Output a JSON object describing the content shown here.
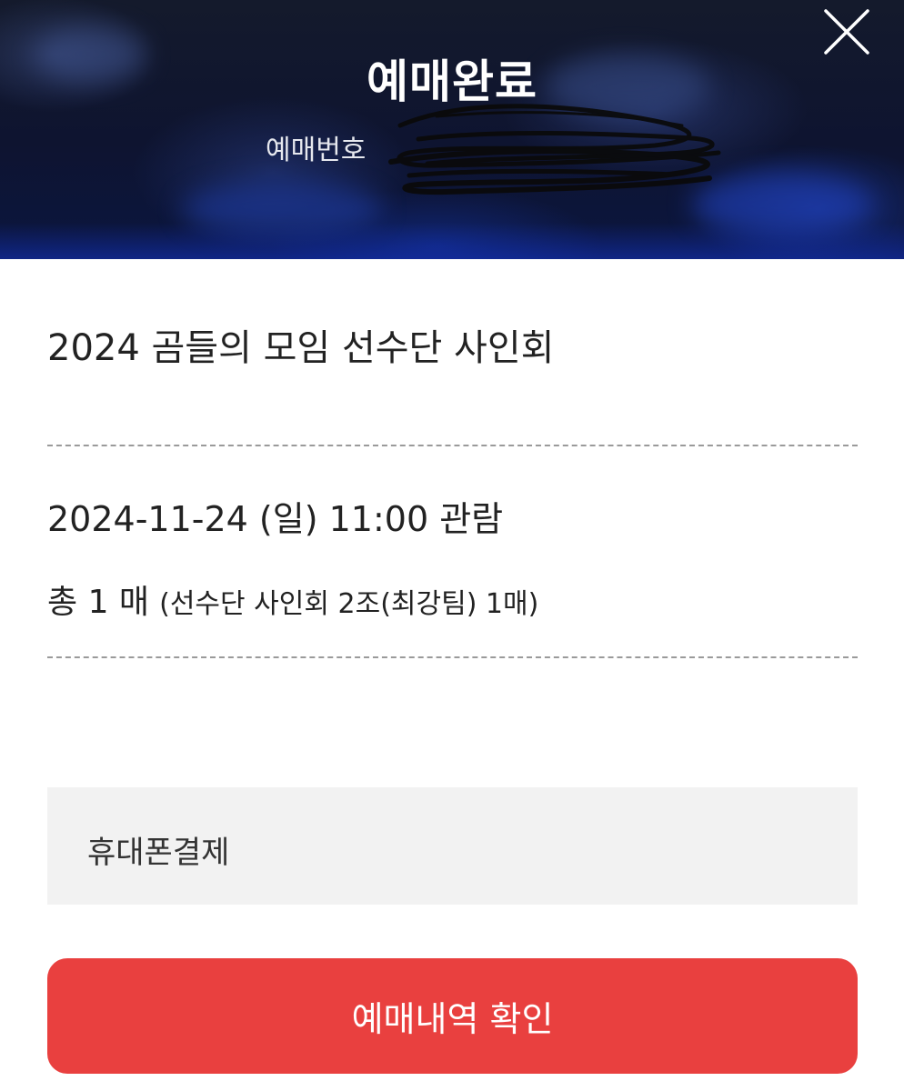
{
  "header": {
    "title": "예매완료",
    "booking_number_label": "예매번호",
    "close_icon": "close-icon"
  },
  "event": {
    "title": "2024 곰들의 모임 선수단 사인회"
  },
  "schedule": {
    "date_line": "2024-11-24 (일) 11:00 관람"
  },
  "tickets": {
    "total": "총 1 매",
    "detail": "(선수단 사인회 2조(최강팀) 1매)"
  },
  "payment": {
    "method": "휴대폰결제"
  },
  "actions": {
    "confirm_label": "예매내역 확인"
  },
  "colors": {
    "accent_button": "#e9403f",
    "payment_bg": "#f2f2f2",
    "header_bg": "#0e1430"
  }
}
